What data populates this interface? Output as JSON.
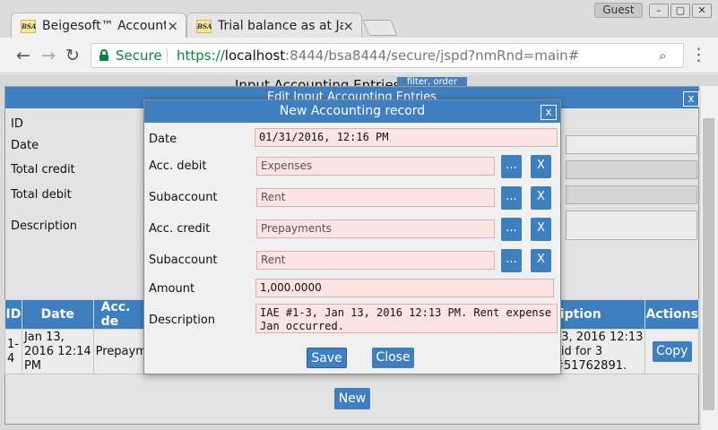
{
  "browser": {
    "tabs": [
      {
        "favicon": "BSA",
        "title": "Beigesoft™ Accounti",
        "close": "×"
      },
      {
        "favicon": "BSA",
        "title": "Trial balance as at Ja",
        "close": "×"
      }
    ],
    "profile": "Guest",
    "window_controls": [
      "–",
      "▢",
      "✕"
    ],
    "nav": {
      "back": "←",
      "forward": "→",
      "reload": "↻"
    },
    "secure_label": "Secure",
    "url": {
      "scheme": "https://",
      "host": "localhost",
      "rest": ":8444/bsa8444/secure/jspd?nmRnd=main#"
    },
    "zoom_icon": "⌕",
    "menu_icon": "⋮"
  },
  "page": {
    "title": "Input Accounting Entries",
    "filter_button": "filter, order"
  },
  "edit_dialog": {
    "title": "Edit Input Accounting Entries",
    "close": "x",
    "labels": {
      "id": "ID",
      "date": "Date",
      "total_credit": "Total credit",
      "total_debit": "Total debit",
      "description": "Description"
    }
  },
  "table": {
    "headers": {
      "id": "ID",
      "date": "Date",
      "acc_debit": "Acc. de",
      "description": "ription",
      "actions": "Actions"
    },
    "row": {
      "id": "1-\n4",
      "date": "Jan 13,\n2016 12:14\nPM",
      "acc_debit": "Prepaym",
      "description": "13, 2016 12:13\naid for 3\n#51762891.",
      "action": "Copy"
    },
    "new_button": "New"
  },
  "modal": {
    "title": "New Accounting record",
    "close": "x",
    "labels": {
      "date": "Date",
      "acc_debit": "Acc. debit",
      "sub_debit": "Subaccount",
      "acc_credit": "Acc. credit",
      "sub_credit": "Subaccount",
      "amount": "Amount",
      "description": "Description"
    },
    "values": {
      "date": "01/31/2016, 12:16 PM",
      "acc_debit": "Expenses",
      "sub_debit": "Rent",
      "acc_credit": "Prepayments",
      "sub_credit": "Rent",
      "amount": "1,000.0000",
      "description": "IAE #1-3, Jan 13, 2016 12:13 PM. Rent expense\nJan occurred."
    },
    "pick_label": "...",
    "clear_label": "X",
    "save": "Save",
    "close_button": "Close"
  },
  "colors": {
    "accent": "#3f7fbf",
    "required_field": "#fde4e4",
    "secure": "#0b8043"
  }
}
